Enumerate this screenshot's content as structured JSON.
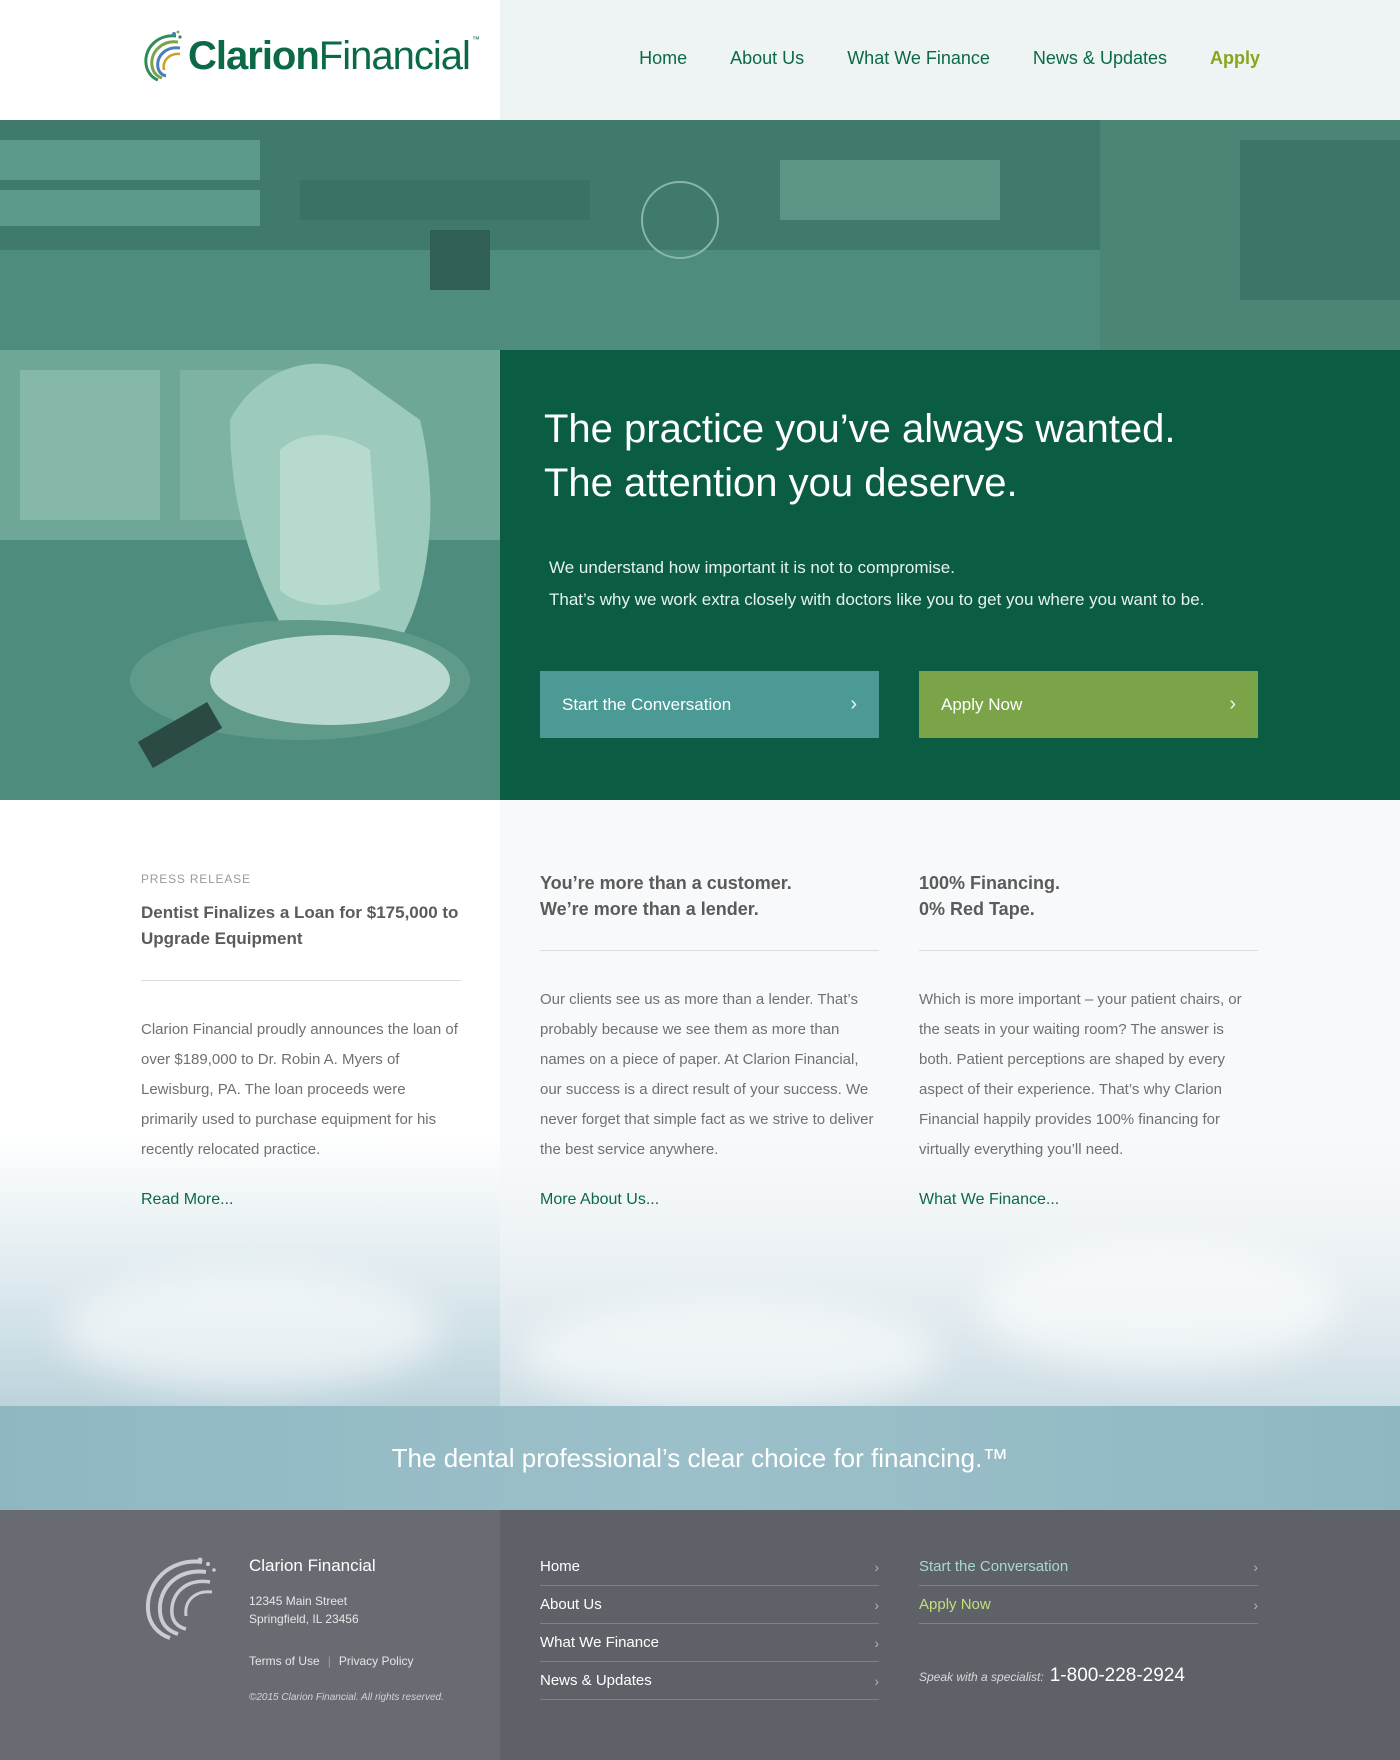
{
  "colors": {
    "brand_green": "#0b6a45",
    "apply_green": "#8aa31c",
    "button_teal": "#4b9a96",
    "button_green": "#7aa447",
    "footer_gray": "#5e6268",
    "tagline_blue": "#9cc0ca"
  },
  "header": {
    "logo": {
      "bold": "Clarion",
      "light": "Financial",
      "tm": "™",
      "icon": "swoosh-logo-icon"
    },
    "nav": [
      {
        "label": "Home"
      },
      {
        "label": "About Us"
      },
      {
        "label": "What We Finance"
      },
      {
        "label": "News & Updates"
      },
      {
        "label": "Apply"
      }
    ]
  },
  "hero": {
    "title_line1": "The practice you’ve always wanted.",
    "title_line2": "The attention you deserve.",
    "sub_line1": "We understand how important it is not to compromise.",
    "sub_line2": "That’s why we work extra closely with doctors like you to get you where you want to be.",
    "btn_talk": "Start the Conversation",
    "btn_apply": "Apply Now",
    "chevron": "›"
  },
  "columns": {
    "press": {
      "kicker": "PRESS RELEASE",
      "heading": "Dentist Finalizes a Loan for $175,000 to Upgrade Equipment",
      "body": "Clarion Financial proudly announces the loan of over $189,000 to Dr. Robin A. Myers of Lewisburg, PA. The loan proceeds were primarily used to purchase equipment for his recently relocated practice.",
      "link": "Read More..."
    },
    "about": {
      "heading_line1": "You’re more than a customer.",
      "heading_line2": "We’re  more than a lender.",
      "body": "Our clients see us as more than a lender. That’s probably because we see them as more than names on a piece of paper. At Clarion Financial, our success is a direct result of your success. We never forget that simple fact as we strive to deliver the best service anywhere.",
      "link": "More About Us..."
    },
    "finance": {
      "heading_line1": "100% Financing.",
      "heading_line2": "0% Red Tape.",
      "body": "Which is more important – your patient chairs, or the seats in your waiting room? The answer is both. Patient perceptions are shaped by every aspect of their experience. That’s why Clarion Financial happily provides 100% financing for virtually everything you’ll need.",
      "link": "What We Finance..."
    }
  },
  "tagline": "The dental professional’s clear choice for financing.™",
  "footer": {
    "company": "Clarion Financial",
    "address_line1": "12345 Main Street",
    "address_line2": "Springfield, IL 23456",
    "terms": "Terms of Use",
    "separator": "|",
    "privacy": "Privacy Policy",
    "copyright": "©2015 Clarion Financial. All rights reserved.",
    "nav": [
      {
        "label": "Home"
      },
      {
        "label": "About Us"
      },
      {
        "label": "What We Finance"
      },
      {
        "label": "News & Updates"
      }
    ],
    "actions": [
      {
        "label": "Start the Conversation"
      },
      {
        "label": "Apply Now"
      }
    ],
    "phone_label": "Speak with a specialist:",
    "phone": "1-800-228-2924",
    "chevron": "›"
  }
}
